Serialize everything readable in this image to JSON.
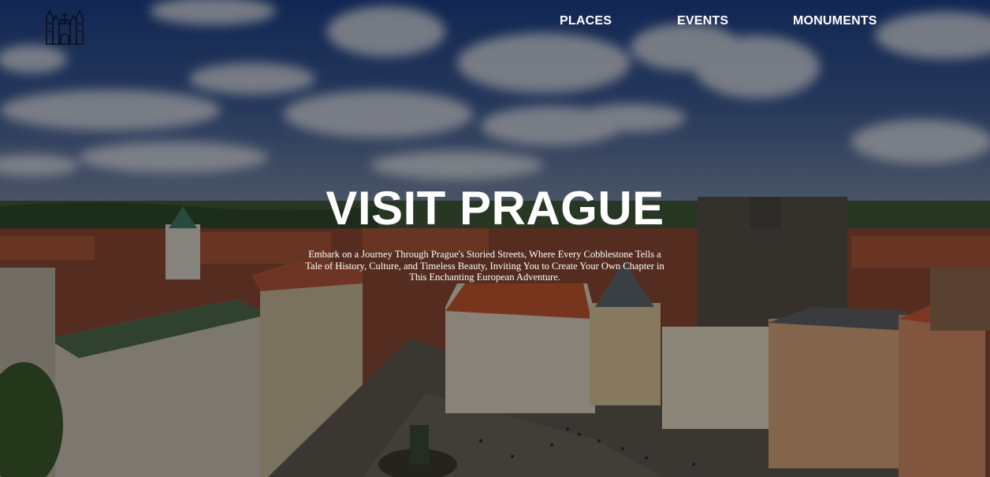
{
  "logo": {
    "icon": "castle-icon"
  },
  "nav": {
    "items": [
      {
        "label": "PLACES"
      },
      {
        "label": "EVENTS"
      },
      {
        "label": "MONUMENTS"
      }
    ]
  },
  "hero": {
    "title": "VISIT PRAGUE",
    "tagline": "Embark on a Journey Through Prague's Storied Streets, Where Every Cobblestone Tells a Tale of History, Culture, and Timeless Beauty, Inviting You to Create Your Own Chapter in This Enchanting European Adventure.",
    "background_image": "prague-old-town-aerial",
    "overlay_color": "#000000"
  }
}
